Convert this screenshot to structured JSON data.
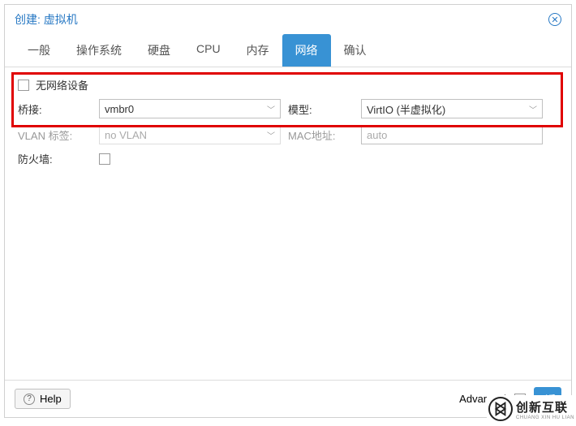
{
  "title": "创建: 虚拟机",
  "tabs": [
    {
      "label": "一般"
    },
    {
      "label": "操作系统"
    },
    {
      "label": "硬盘"
    },
    {
      "label": "CPU"
    },
    {
      "label": "内存"
    },
    {
      "label": "网络"
    },
    {
      "label": "确认"
    }
  ],
  "active_tab_index": 5,
  "form": {
    "no_network_label": "无网络设备",
    "bridge_label": "桥接:",
    "bridge_value": "vmbr0",
    "model_label": "模型:",
    "model_value": "VirtIO (半虚拟化)",
    "vlan_label": "VLAN 标签:",
    "vlan_value": "no VLAN",
    "mac_label": "MAC地址:",
    "mac_value": "auto",
    "firewall_label": "防火墙:"
  },
  "footer": {
    "help_label": "Help",
    "advanced_label": "Advanced",
    "back_label": "返"
  },
  "watermark": {
    "cn": "创新互联",
    "en": "CHUANG XIN HU LIAN"
  }
}
